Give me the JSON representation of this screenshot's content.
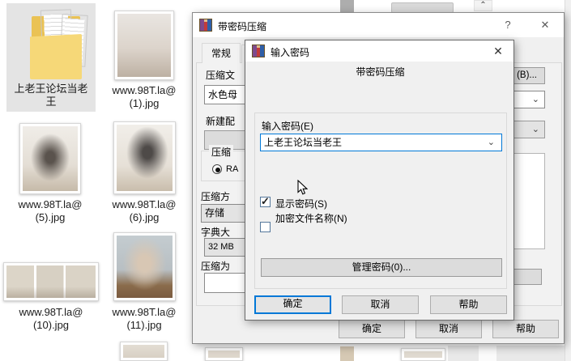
{
  "icons": {
    "help": "?",
    "close": "✕",
    "chevron_down": "⌄",
    "chevron_up": "⌃",
    "check": "✓"
  },
  "colors": {
    "accent": "#0078d7",
    "dialog_bg": "#f0f0f0",
    "selection_bg": "#e4e4e4"
  },
  "explorer": {
    "folder": {
      "line1": "上老王论坛当老",
      "line2": "王"
    },
    "files": [
      {
        "top": "www.98T.la@",
        "bottom": "(1).jpg"
      },
      {
        "top": "www.98T.la@",
        "bottom": "(5).jpg"
      },
      {
        "top": "www.98T.la@",
        "bottom": "(6).jpg"
      },
      {
        "top": "www.98T.la@",
        "bottom": "(10).jpg"
      },
      {
        "top": "www.98T.la@",
        "bottom": "(11).jpg"
      }
    ]
  },
  "main_dialog": {
    "title": "带密码压缩",
    "tab_general": "常规",
    "archive_name_label": "压缩文",
    "archive_name_value": "水色母",
    "profile_label": "新建配",
    "format_group_label": "压缩",
    "format_radio_label": "RA",
    "method_label": "压缩方",
    "method_value": "存储",
    "dictionary_label": "字典大",
    "dictionary_value": "32 MB",
    "volume_label": "压缩为",
    "browse_button": "(B)...",
    "ok": "确定",
    "cancel": "取消",
    "help": "帮助"
  },
  "password_dialog": {
    "title": "输入密码",
    "heading": "带密码压缩",
    "password_label": "输入密码(E)",
    "password_value": "上老王论坛当老王",
    "show_password_label": "显示密码(S)",
    "encrypt_names_label": "加密文件名称(N)",
    "manage_passwords_button": "管理密码(0)...",
    "ok": "确定",
    "cancel": "取消",
    "help": "帮助"
  }
}
